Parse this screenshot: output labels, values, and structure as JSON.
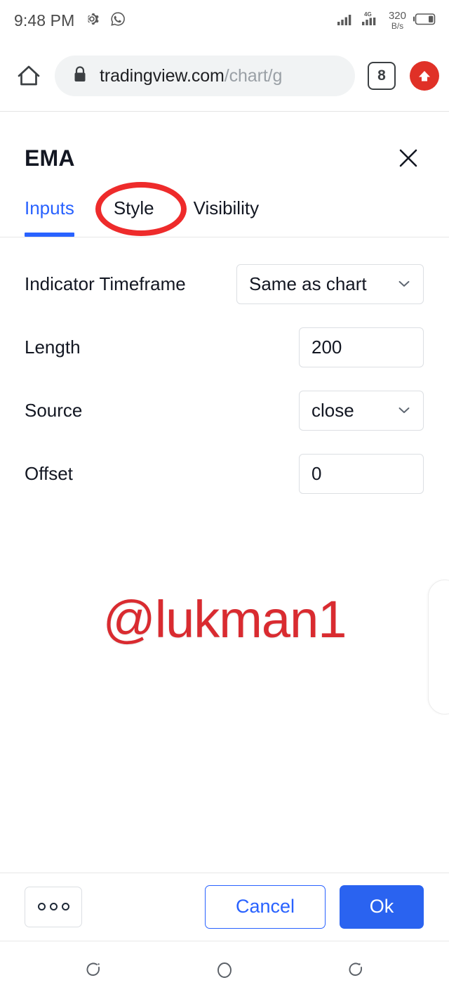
{
  "status_bar": {
    "time": "9:48 PM",
    "gear_icon": "gear-icon",
    "whatsapp_icon": "whatsapp-icon",
    "signal_icon": "signal-bars-icon",
    "network_type": "4G",
    "data_rate_value": "320",
    "data_rate_unit": "B/s",
    "battery_icon": "battery-icon"
  },
  "browser": {
    "home_icon": "home-icon",
    "lock_icon": "lock-icon",
    "url_domain": "tradingview.com",
    "url_path": "/chart/g",
    "tab_count": "8",
    "upload_icon": "upload-arrow-icon"
  },
  "dialog": {
    "title": "EMA",
    "close_icon": "close-icon",
    "tabs": [
      {
        "label": "Inputs",
        "active": true
      },
      {
        "label": "Style",
        "active": false
      },
      {
        "label": "Visibility",
        "active": false
      }
    ],
    "annotation": {
      "target": "Style",
      "color": "#ee2b2b",
      "shape": "ellipse"
    },
    "fields": [
      {
        "label": "Indicator Timeframe",
        "type": "select",
        "value": "Same as chart",
        "chevron_icon": "chevron-down-icon"
      },
      {
        "label": "Length",
        "type": "text",
        "value": "200"
      },
      {
        "label": "Source",
        "type": "select",
        "value": "close",
        "chevron_icon": "chevron-down-icon"
      },
      {
        "label": "Offset",
        "type": "text",
        "value": "0"
      }
    ],
    "watermark": "@lukman1",
    "footer": {
      "more_label": "more-options",
      "cancel_label": "Cancel",
      "ok_label": "Ok"
    }
  },
  "nav_bar": {
    "recents_icon": "recents-icon",
    "home_icon": "home-circle-icon",
    "back_icon": "back-icon"
  },
  "colors": {
    "accent_blue": "#2962ff",
    "ok_blue": "#2a63f0",
    "annotation_red": "#ee2b2b",
    "watermark_red": "#d92b30",
    "upload_red": "#e03127",
    "text_dark": "#131722"
  }
}
